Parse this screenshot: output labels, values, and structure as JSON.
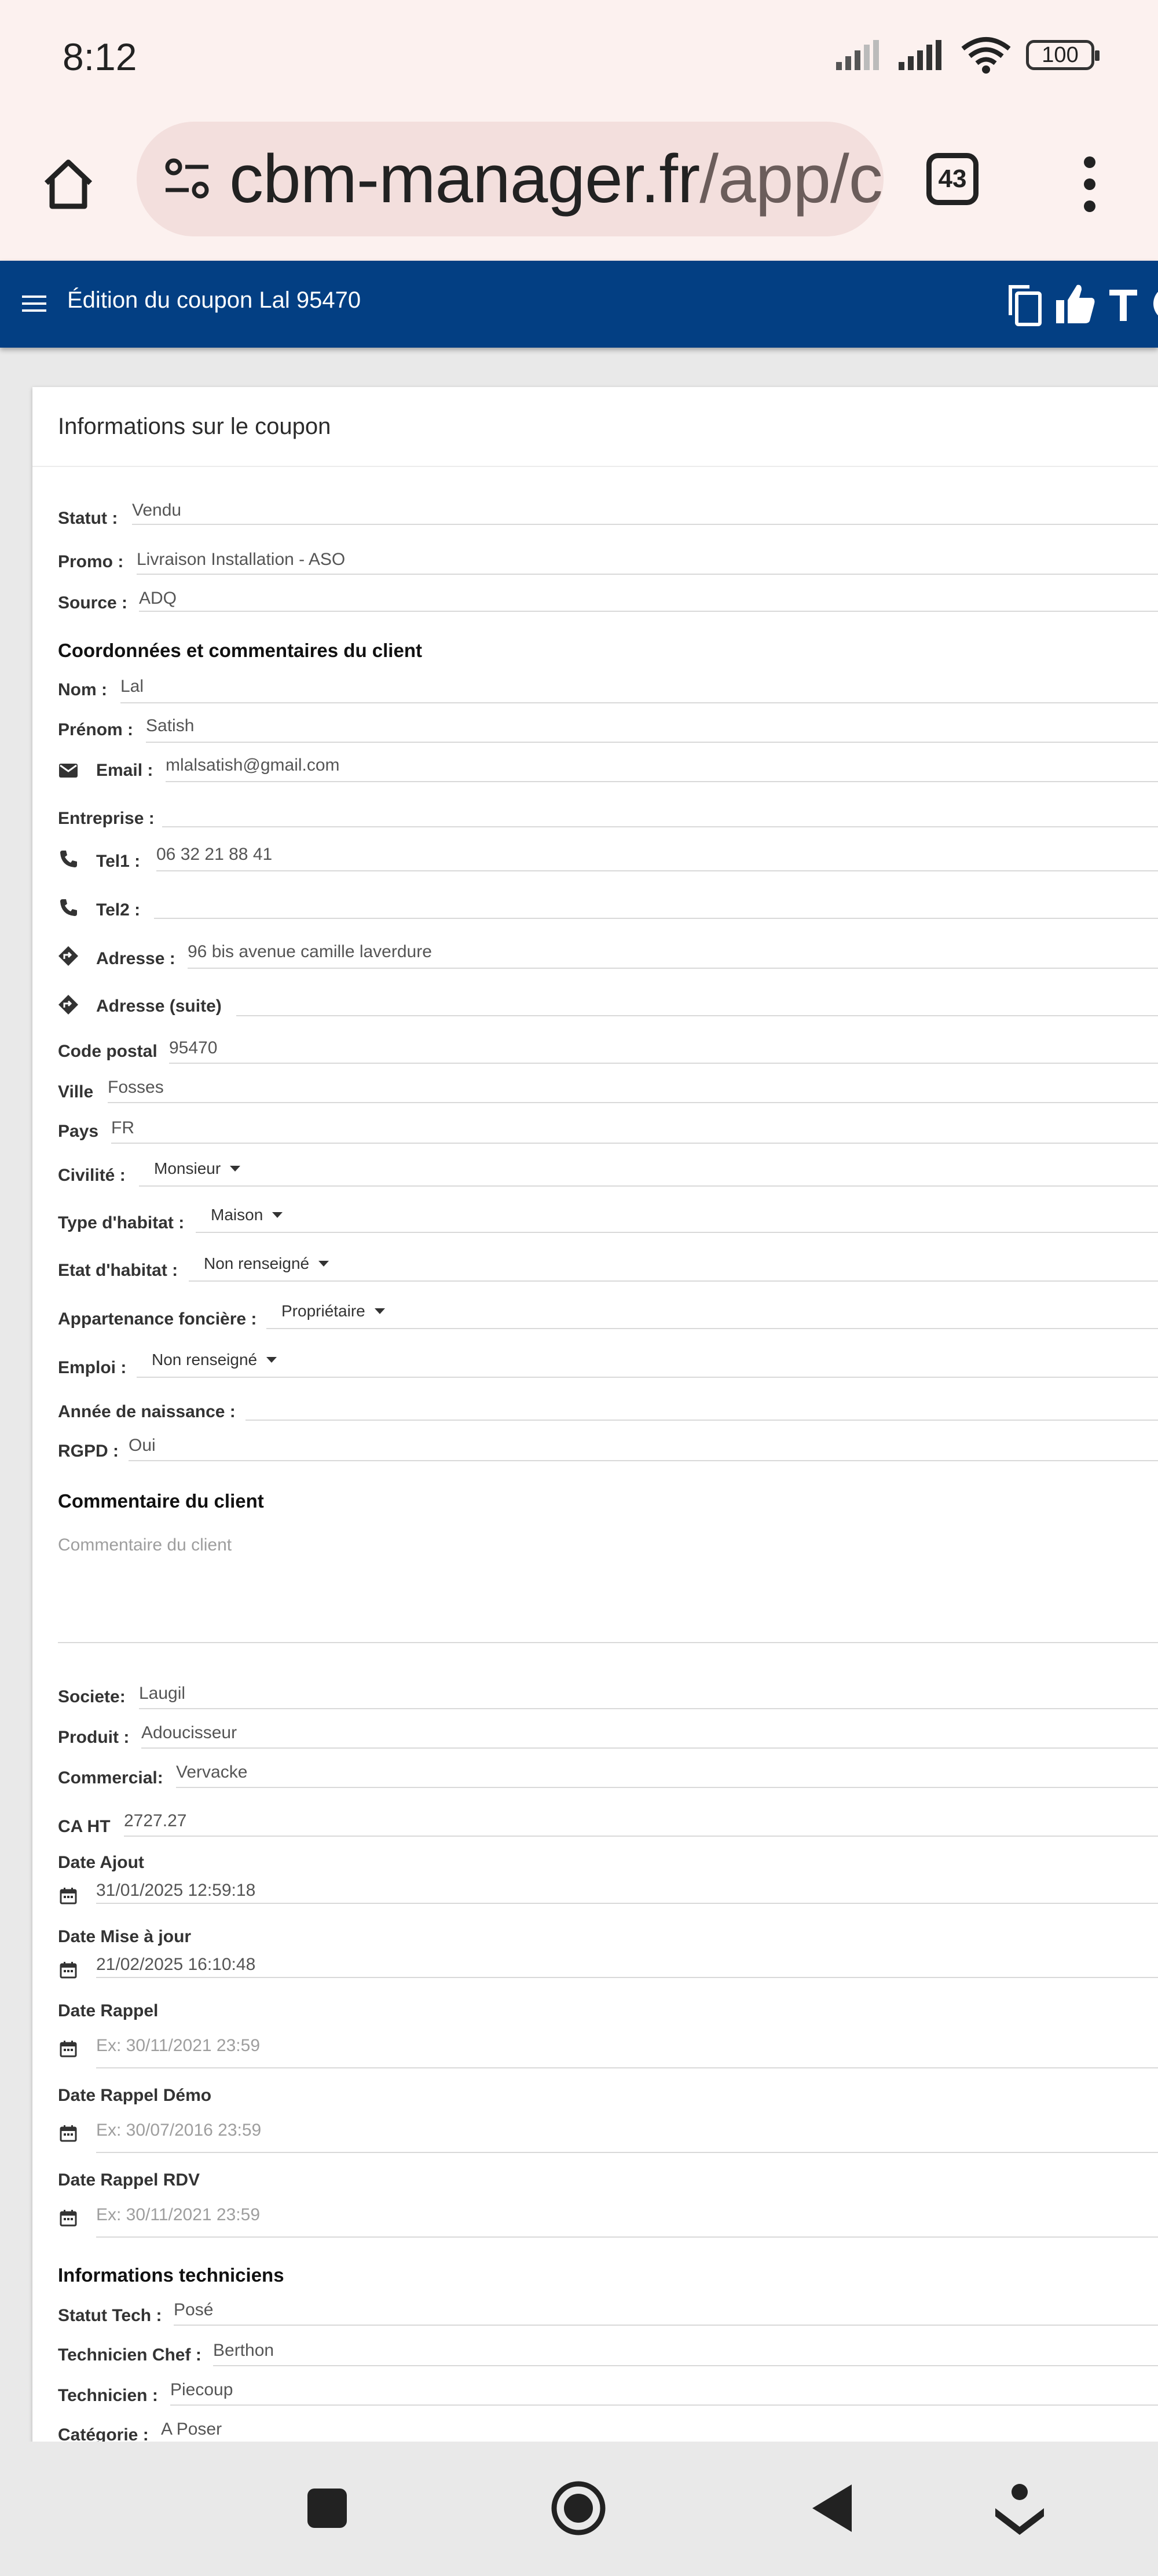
{
  "status_bar": {
    "time": "8:12",
    "battery": "100"
  },
  "browser": {
    "url_main": "cbm-manager.fr",
    "url_rest": "/app/c",
    "tab_count": "43"
  },
  "appbar": {
    "title": "Édition du coupon Lal 95470"
  },
  "card": {
    "title": "Informations sur le coupon",
    "statut": {
      "label": "Statut :",
      "value": "Vendu"
    },
    "promo": {
      "label": "Promo :",
      "value": "Livraison Installation - ASO"
    },
    "source": {
      "label": "Source :",
      "value": "ADQ"
    },
    "section_client": "Coordonnées et commentaires du client",
    "nom": {
      "label": "Nom :",
      "value": "Lal"
    },
    "prenom": {
      "label": "Prénom :",
      "value": "Satish"
    },
    "email": {
      "label": "Email :",
      "value": "mlalsatish@gmail.com"
    },
    "entreprise": {
      "label": "Entreprise :",
      "value": ""
    },
    "tel1": {
      "label": "Tel1 :",
      "value": "06 32 21 88 41"
    },
    "tel2": {
      "label": "Tel2 :",
      "value": ""
    },
    "adresse": {
      "label": "Adresse :",
      "value": "96 bis avenue camille laverdure"
    },
    "adresse_suite": {
      "label": "Adresse (suite)",
      "value": ""
    },
    "code_postal": {
      "label": "Code postal",
      "value": "95470"
    },
    "ville": {
      "label": "Ville",
      "value": "Fosses"
    },
    "pays": {
      "label": "Pays",
      "value": "FR"
    },
    "civilite": {
      "label": "Civilité :",
      "value": "Monsieur"
    },
    "type_habitat": {
      "label": "Type d'habitat :",
      "value": "Maison"
    },
    "etat_habitat": {
      "label": "Etat d'habitat :",
      "value": "Non renseigné"
    },
    "appartenance": {
      "label": "Appartenance foncière :",
      "value": "Propriétaire"
    },
    "emploi": {
      "label": "Emploi :",
      "value": "Non renseigné"
    },
    "annee_naissance": {
      "label": "Année de naissance :",
      "value": ""
    },
    "rgpd": {
      "label": "RGPD :",
      "value": "Oui"
    },
    "section_commentaire": "Commentaire du client",
    "commentaire_placeholder": "Commentaire du client",
    "societe": {
      "label": "Societe:",
      "value": "Laugil"
    },
    "produit": {
      "label": "Produit :",
      "value": "Adoucisseur"
    },
    "commercial": {
      "label": "Commercial:",
      "value": "Vervacke"
    },
    "ca_ht": {
      "label": "CA HT",
      "value": "2727.27"
    },
    "date_ajout": {
      "label": "Date Ajout",
      "value": "31/01/2025 12:59:18"
    },
    "date_maj": {
      "label": "Date Mise à jour",
      "value": "21/02/2025 16:10:48"
    },
    "date_rappel": {
      "label": "Date Rappel",
      "placeholder": "Ex: 30/11/2021 23:59"
    },
    "date_rappel_demo": {
      "label": "Date Rappel Démo",
      "placeholder": "Ex: 30/07/2016 23:59"
    },
    "date_rappel_rdv": {
      "label": "Date Rappel RDV",
      "placeholder": "Ex: 30/11/2021 23:59"
    },
    "section_tech": "Informations techniciens",
    "statut_tech": {
      "label": "Statut Tech :",
      "value": "Posé"
    },
    "tech_chef": {
      "label": "Technicien Chef :",
      "value": "Berthon"
    },
    "technicien": {
      "label": "Technicien :",
      "value": "Piecoup"
    },
    "categorie": {
      "label": "Catégorie :",
      "value": "A Poser"
    }
  },
  "icons": {
    "email": "email-icon",
    "phone": "phone-icon",
    "direction": "directions-icon",
    "calendar": "calendar-icon"
  },
  "colors": {
    "appbar": "#033f83",
    "chrome": "#fcf1ef",
    "urlbox": "#f3dfdd"
  }
}
